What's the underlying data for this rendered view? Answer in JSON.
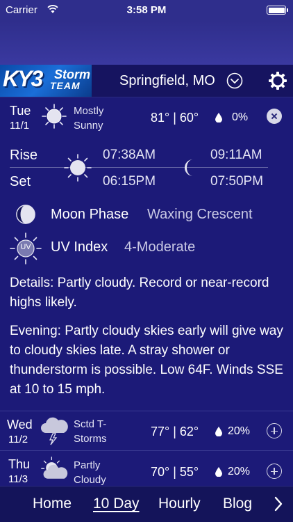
{
  "status": {
    "carrier": "Carrier",
    "time": "3:58 PM"
  },
  "header": {
    "logo": {
      "ky3": "KY3",
      "storm": "Storm",
      "team": "TEAM"
    },
    "location": "Springfield, MO"
  },
  "today": {
    "day": "Tue",
    "date": "11/1",
    "condition_line1": "Mostly",
    "condition_line2": "Sunny",
    "temps": "81° | 60°",
    "precip": "0%",
    "sun": {
      "rise_label": "Rise",
      "set_label": "Set",
      "rise": "07:38AM",
      "set": "06:15PM"
    },
    "moon": {
      "rise": "09:11AM",
      "set": "07:50PM"
    },
    "moon_phase_label": "Moon Phase",
    "moon_phase_value": "Waxing Crescent",
    "uv_badge": "UV",
    "uv_label": "UV Index",
    "uv_value": "4-Moderate",
    "details": "Details: Partly cloudy. Record or near-record highs likely.",
    "evening": "Evening: Partly cloudy skies early will give way to cloudy skies late. A stray shower or thunderstorm is possible. Low 64F. Winds SSE at 10 to 15 mph."
  },
  "days": [
    {
      "day": "Wed",
      "date": "11/2",
      "condition_line1": "Sctd T-",
      "condition_line2": "Storms",
      "temps": "77° | 62°",
      "precip": "20%",
      "icon": "thunderstorm-icon"
    },
    {
      "day": "Thu",
      "date": "11/3",
      "condition_line1": "Partly",
      "condition_line2": "Cloudy",
      "temps": "70° | 55°",
      "precip": "20%",
      "icon": "partly-cloudy-icon"
    }
  ],
  "nav": {
    "items": [
      "Home",
      "10 Day",
      "Hourly",
      "Blog"
    ],
    "active": "10 Day"
  },
  "colors": {
    "background": "#14145a",
    "panel": "#1c1a78",
    "status_bar": "#2f2e8c",
    "logo_blue": "#1a6ed8"
  }
}
